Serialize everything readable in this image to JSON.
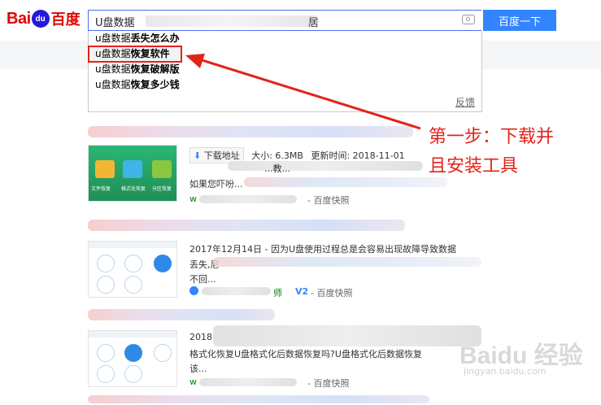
{
  "logo": {
    "bai": "Bai",
    "du": "du",
    "du_cn": "百度"
  },
  "search": {
    "query": "U盘数据",
    "query_tail": "居",
    "button": "百度一下"
  },
  "suggestions": [
    {
      "prefix": "u盘数据",
      "rest": "丢失怎么办"
    },
    {
      "prefix": "u盘数据",
      "rest": "恢复软件"
    },
    {
      "prefix": "u盘数据",
      "rest": "恢复破解版"
    },
    {
      "prefix": "u盘数据",
      "rest": "恢复多少钱"
    }
  ],
  "feedback": "反馈",
  "annotation": {
    "line1": "第一步：下载并",
    "line2": "且安装工具"
  },
  "results": [
    {
      "download": "下载地址",
      "size": "大小: 6.3MB",
      "updated": "更新时间: 2018-11-01",
      "snippet_a": "如果您吓吩...",
      "snippet_b": "...教...",
      "url": "w",
      "kuaizhao": "百度快照",
      "thumb_labels": [
        "文件恢复",
        "格式化恢复",
        "分区恢复"
      ]
    },
    {
      "date": "2017年12月14日 - 因为U盘使用过程总是会容易出现故障导致数据",
      "snippet_a": "丢失,尼",
      "snippet_b": "不回...",
      "v": "V2",
      "suffix": "师",
      "kuaizhao": "百度快照"
    },
    {
      "date": "2018",
      "snippet_a": "格式化恢复U盘格式化后数据恢复吗?U盘格式化后数据恢复",
      "snippet_b": "该...",
      "url": "w",
      "kuaizhao": "百度快照"
    }
  ],
  "watermark": {
    "text": "Baidu 经验",
    "url": "jingyan.baidu.com"
  }
}
